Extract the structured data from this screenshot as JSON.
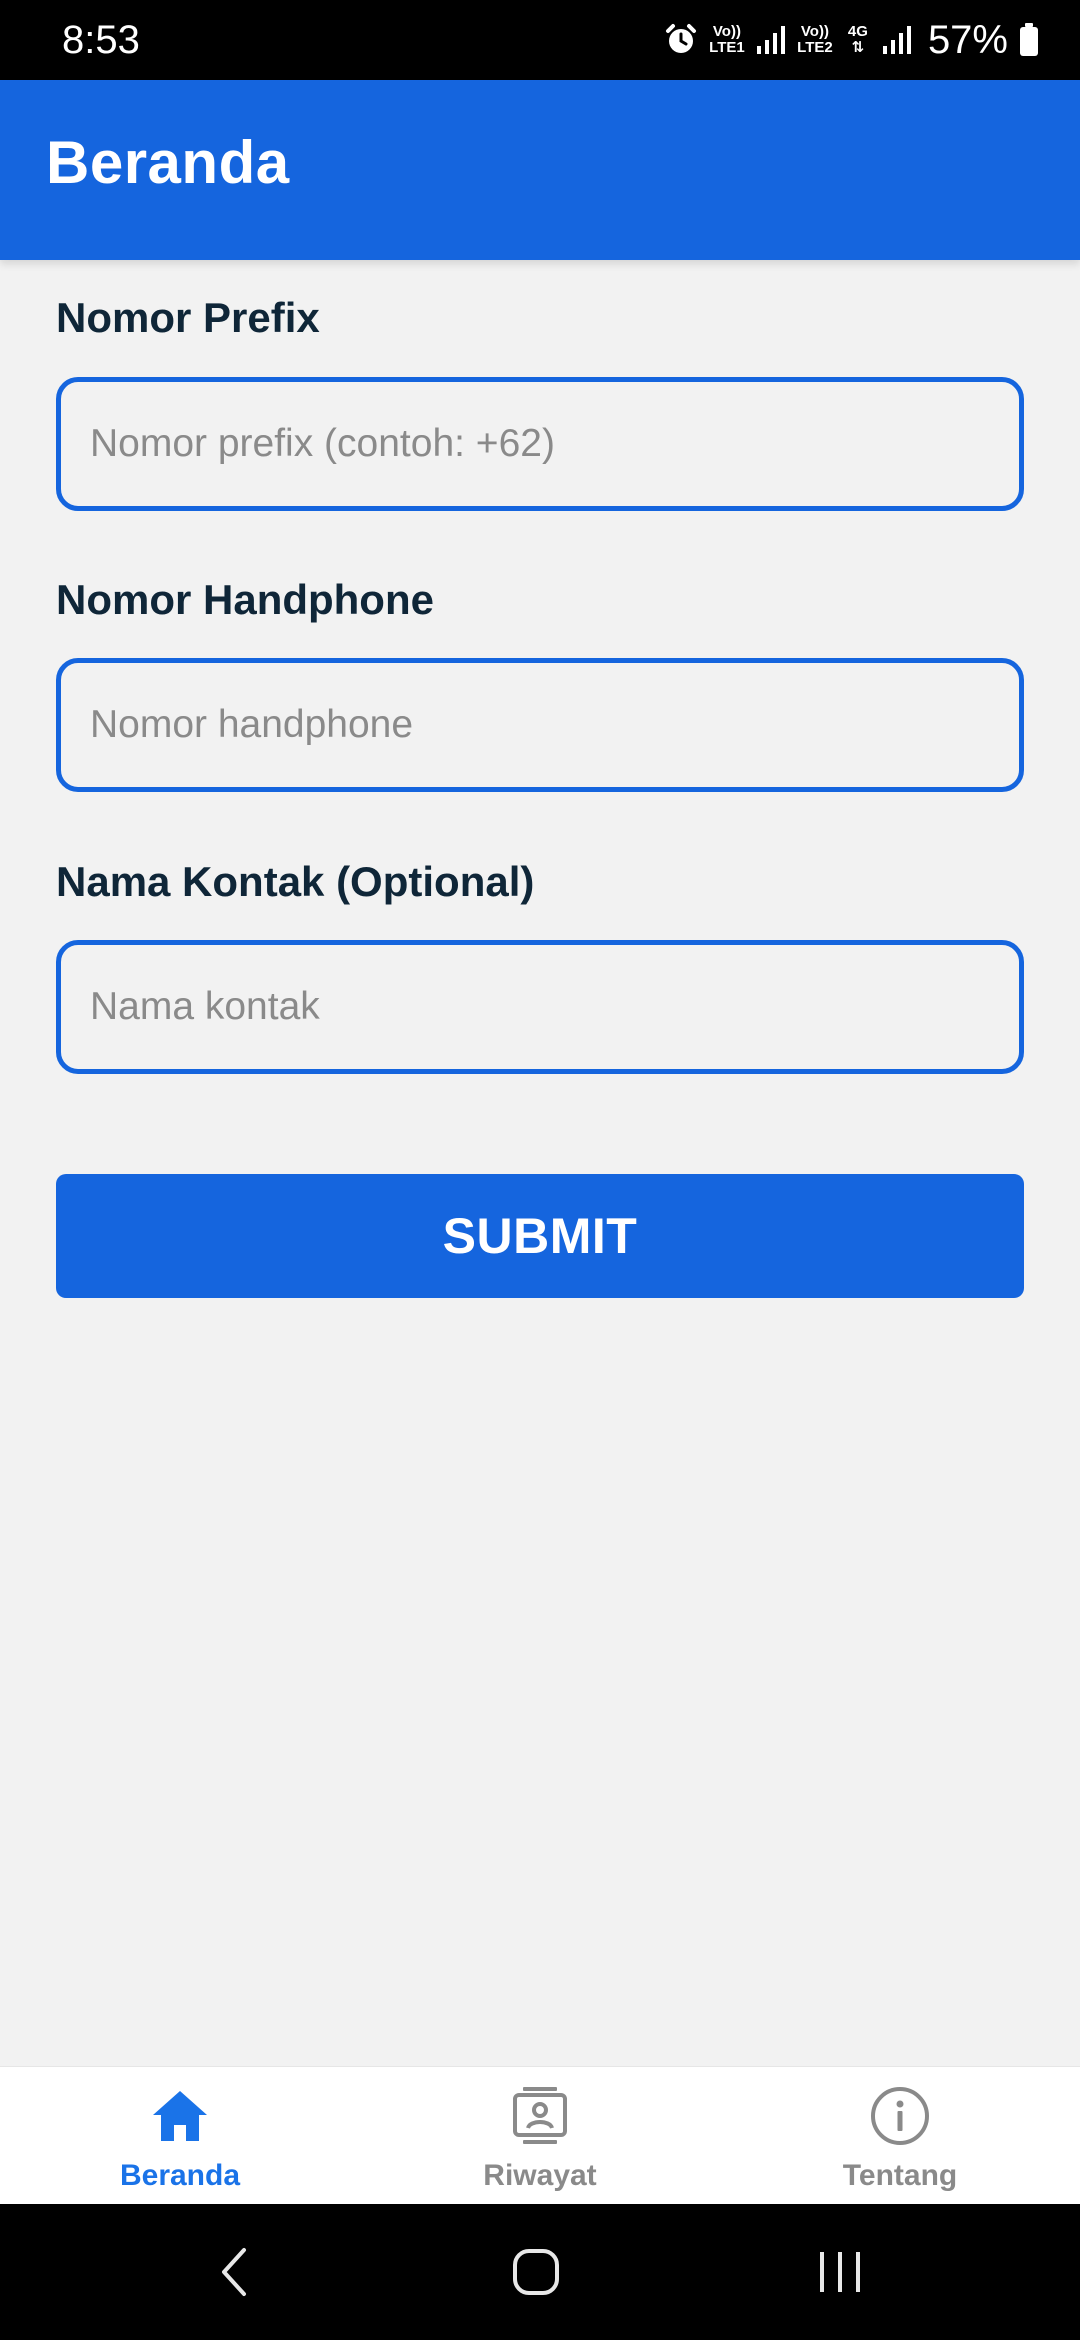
{
  "status_bar": {
    "time": "8:53",
    "sim1_top": "Vo))",
    "sim1_bottom": "LTE1",
    "sim2_top": "Vo))",
    "sim2_bottom": "LTE2",
    "network": "4G",
    "battery": "57%",
    "icons": [
      "alarm-icon",
      "signal-icon",
      "signal-icon",
      "battery-icon"
    ]
  },
  "app_bar": {
    "title": "Beranda",
    "color": "#1565de"
  },
  "form": {
    "prefix": {
      "label": "Nomor Prefix",
      "placeholder": "Nomor prefix (contoh: +62)",
      "value": ""
    },
    "phone": {
      "label": "Nomor Handphone",
      "placeholder": "Nomor handphone",
      "value": ""
    },
    "contact": {
      "label": "Nama Kontak (Optional)",
      "placeholder": "Nama kontak",
      "value": ""
    },
    "submit_label": "SUBMIT"
  },
  "bottom_nav": {
    "items": [
      {
        "label": "Beranda",
        "icon": "home-icon",
        "active": true
      },
      {
        "label": "Riwayat",
        "icon": "contact-card-icon",
        "active": false
      },
      {
        "label": "Tentang",
        "icon": "info-icon",
        "active": false
      }
    ],
    "active_color": "#1a73e8",
    "inactive_color": "#8a8a8a"
  },
  "system_nav": {
    "icons": [
      "back-icon",
      "home-circle-icon",
      "recents-icon"
    ]
  }
}
